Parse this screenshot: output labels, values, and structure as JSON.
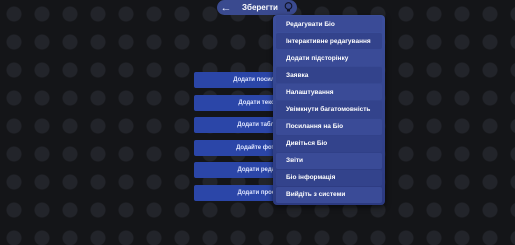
{
  "topbar": {
    "back_icon": "arrow-left-icon",
    "title": "Зберегти",
    "bulb_icon": "lightbulb-icon"
  },
  "add_buttons": [
    {
      "label": "Додати посила"
    },
    {
      "label": "Додати тексо"
    },
    {
      "label": "Додати табли"
    },
    {
      "label": "Додайте фото"
    },
    {
      "label": "Додати редак"
    },
    {
      "label": "Додати прост"
    }
  ],
  "menu": {
    "items": [
      {
        "label": "Редагувати Біо"
      },
      {
        "label": "Інтерактивне редагування"
      },
      {
        "label": "Додати підсторінку"
      },
      {
        "label": "Заявка"
      },
      {
        "label": "Налаштування"
      },
      {
        "label": "Увімкнути багатомовність"
      },
      {
        "label": "Посилання на Біо"
      },
      {
        "label": "Дивіться Біо"
      },
      {
        "label": "Звіти"
      },
      {
        "label": "Біо інформація"
      },
      {
        "label": "Вийдіть з системи"
      }
    ]
  },
  "colors": {
    "background": "#141518",
    "accent": "#3a4a8f",
    "button": "#2b46a8"
  }
}
